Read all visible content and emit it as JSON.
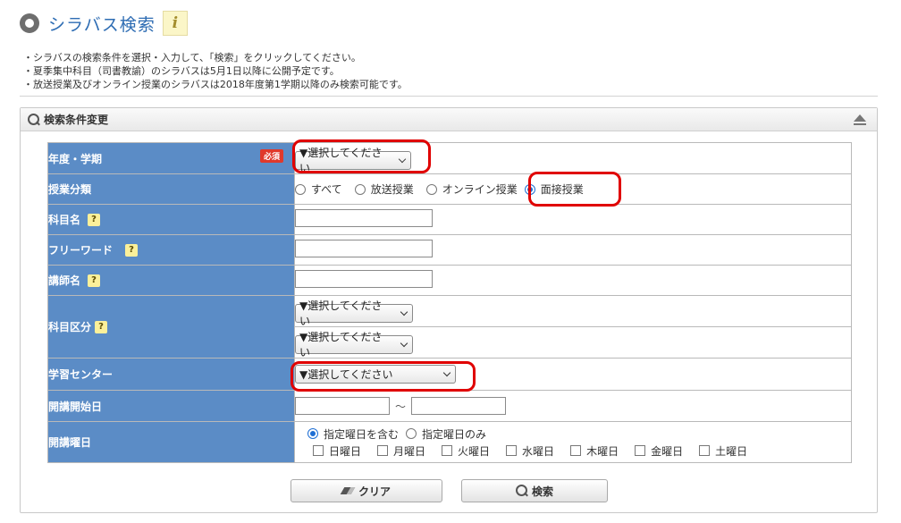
{
  "header": {
    "title": "シラバス検索",
    "info_glyph": "i"
  },
  "notes": [
    "・シラバスの検索条件を選択・入力して、「検索」をクリックしてください。",
    "・夏季集中科目（司書教諭）のシラバスは5月1日以降に公開予定です。",
    "・放送授業及びオンライン授業のシラバスは2018年度第1学期以降のみ検索可能です。"
  ],
  "panel": {
    "title": "検索条件変更"
  },
  "form": {
    "year_term": {
      "label": "年度・学期",
      "required": "必須",
      "select": "▼選択してください"
    },
    "class_type": {
      "label": "授業分類",
      "options": [
        "すべて",
        "放送授業",
        "オンライン授業",
        "面接授業"
      ],
      "selected": "面接授業"
    },
    "subject_name": {
      "label": "科目名",
      "help": "?",
      "value": ""
    },
    "free_word": {
      "label": "フリーワード",
      "help": "?",
      "value": ""
    },
    "lecturer": {
      "label": "講師名",
      "help": "?",
      "value": ""
    },
    "subject_category": {
      "label": "科目区分",
      "help": "?",
      "select1": "▼選択してください",
      "select2": "▼選択してください"
    },
    "study_center": {
      "label": "学習センター",
      "select": "▼選択してください"
    },
    "start_date": {
      "label": "開講開始日",
      "from": "",
      "to": "",
      "tilde": "～"
    },
    "weekday": {
      "label": "開講曜日",
      "modes": [
        "指定曜日を含む",
        "指定曜日のみ"
      ],
      "mode_selected": "指定曜日を含む",
      "days": [
        "日曜日",
        "月曜日",
        "火曜日",
        "水曜日",
        "木曜日",
        "金曜日",
        "土曜日"
      ]
    }
  },
  "buttons": {
    "clear": "クリア",
    "search": "検索"
  },
  "colors": {
    "label_bg": "#5b8cc6",
    "highlight": "#e00000",
    "title": "#2d6cb3"
  }
}
